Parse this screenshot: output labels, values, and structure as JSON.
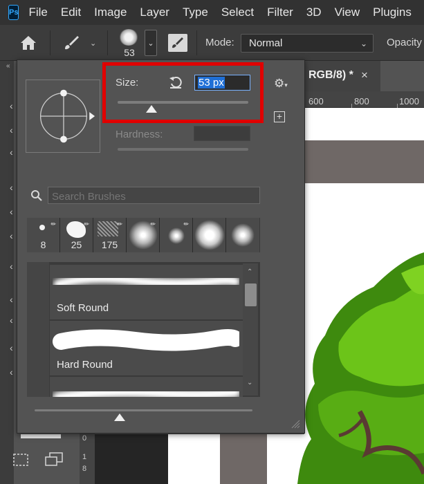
{
  "app": {
    "logo": "Ps"
  },
  "menu": [
    "File",
    "Edit",
    "Image",
    "Layer",
    "Type",
    "Select",
    "Filter",
    "3D",
    "View",
    "Plugins"
  ],
  "options_bar": {
    "preset_size": "53",
    "mode_label": "Mode:",
    "mode_value": "Normal",
    "opacity_label": "Opacity"
  },
  "document": {
    "tab_title": "RGB/8) *",
    "ruler_marks": [
      "600",
      "800",
      "1000"
    ]
  },
  "brush_panel": {
    "size_label": "Size:",
    "size_value": "53 px",
    "size_slider_fraction": 0.26,
    "hardness_label": "Hardness:",
    "search_placeholder": "Search Brushes",
    "recent_brushes": [
      {
        "size": "8"
      },
      {
        "size": "25"
      },
      {
        "size": "175"
      },
      {
        "size": ""
      },
      {
        "size": ""
      },
      {
        "size": ""
      },
      {
        "size": ""
      }
    ],
    "brushes": [
      {
        "name": "Soft Round"
      },
      {
        "name": "Hard Round"
      }
    ],
    "preview_slider_fraction": 0.39
  },
  "colors": {
    "highlight": "#e00000",
    "selection": "#1f6fd6",
    "tree_green": "#4f9a12"
  }
}
